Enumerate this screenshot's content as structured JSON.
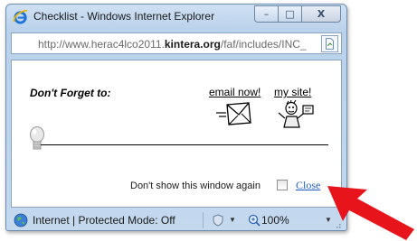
{
  "window": {
    "title": "Checklist - Windows Internet Explorer",
    "min_glyph": "–",
    "max_glyph": "□",
    "close_glyph": "X"
  },
  "address": {
    "prefix": "http://www.herac4lco2011.",
    "domain": "kintera.org",
    "suffix": "/faf/includes/INC_"
  },
  "content": {
    "heading": "Don't Forget to:",
    "email_link": "email now!",
    "site_link": "my site!",
    "dont_show_label": "Don't show this window again",
    "close_link": "Close"
  },
  "status": {
    "zone_text": "Internet | Protected Mode: Off",
    "zoom_text": "100%"
  },
  "colors": {
    "link_blue": "#1f5fc4",
    "arrow_red": "#e8141b",
    "frame_blue": "#b9d1ea"
  }
}
